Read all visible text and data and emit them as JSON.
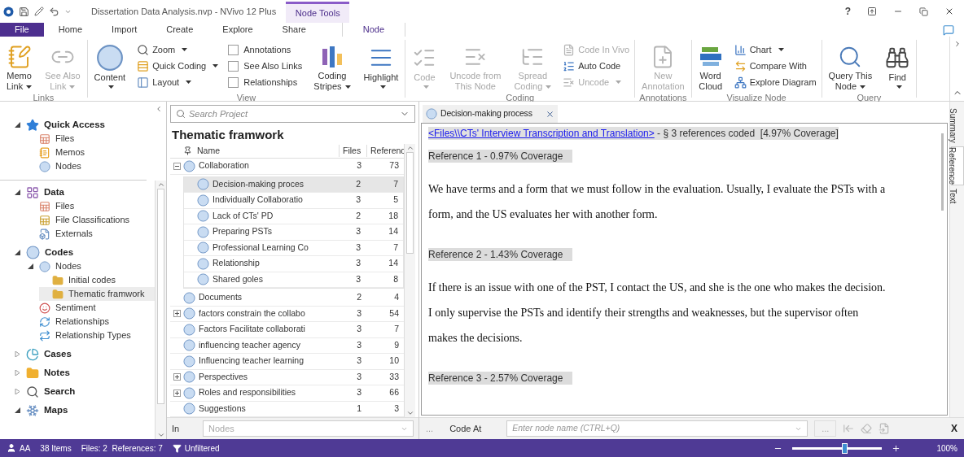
{
  "title_bar": {
    "title": "Dissertation Data Analysis.nvp - NVivo 12 Plus",
    "context_tab": "Node Tools",
    "help": "?"
  },
  "menu_tabs": [
    {
      "label": "File",
      "kind": "file",
      "selected": false
    },
    {
      "label": "Home",
      "kind": "tab",
      "selected": false
    },
    {
      "label": "Import",
      "kind": "tab",
      "selected": false
    },
    {
      "label": "Create",
      "kind": "tab",
      "selected": false
    },
    {
      "label": "Explore",
      "kind": "tab",
      "selected": false
    },
    {
      "label": "Share",
      "kind": "tab",
      "selected": false
    },
    {
      "label": "Node",
      "kind": "context",
      "selected": true
    }
  ],
  "ribbon": [
    {
      "label": "Links",
      "items": [
        {
          "kind": "large",
          "lines": [
            "Memo",
            "Link"
          ],
          "dropdown": true,
          "disabled": false
        },
        {
          "kind": "large",
          "lines": [
            "See Also",
            "Link"
          ],
          "dropdown": true,
          "disabled": true
        }
      ]
    },
    {
      "label": "View",
      "items": [
        {
          "kind": "large",
          "lines": [
            "Content"
          ],
          "dropdown": true,
          "disabled": false
        },
        {
          "kind": "stack",
          "items": [
            {
              "kind": "small",
              "label": "Zoom",
              "dropdown": true,
              "disabled": false
            },
            {
              "kind": "small",
              "label": "Quick Coding",
              "dropdown": true,
              "disabled": false
            },
            {
              "kind": "small",
              "label": "Layout",
              "dropdown": true,
              "disabled": false
            }
          ]
        },
        {
          "kind": "stack",
          "items": [
            {
              "kind": "check",
              "label": "Annotations",
              "checked": false
            },
            {
              "kind": "check",
              "label": "See Also Links",
              "checked": false
            },
            {
              "kind": "check",
              "label": "Relationships",
              "checked": false
            }
          ]
        },
        {
          "kind": "large",
          "lines": [
            "Coding",
            "Stripes"
          ],
          "dropdown": true,
          "disabled": false
        },
        {
          "kind": "large",
          "lines": [
            "Highlight"
          ],
          "dropdown": true,
          "disabled": false
        }
      ]
    },
    {
      "label": "Coding",
      "items": [
        {
          "kind": "large",
          "lines": [
            "Code"
          ],
          "dropdown": true,
          "disabled": true
        },
        {
          "kind": "large",
          "lines": [
            "Uncode from",
            "This Node"
          ],
          "dropdown": false,
          "disabled": true
        },
        {
          "kind": "large",
          "lines": [
            "Spread",
            "Coding"
          ],
          "dropdown": true,
          "disabled": true
        },
        {
          "kind": "stack",
          "items": [
            {
              "kind": "small",
              "label": "Code In Vivo",
              "dropdown": false,
              "disabled": true
            },
            {
              "kind": "small",
              "label": "Auto Code",
              "dropdown": false,
              "disabled": false
            },
            {
              "kind": "small",
              "label": "Uncode",
              "dropdown": true,
              "disabled": true
            }
          ]
        }
      ]
    },
    {
      "label": "Annotations",
      "items": [
        {
          "kind": "large",
          "lines": [
            "New",
            "Annotation"
          ],
          "dropdown": false,
          "disabled": true
        }
      ]
    },
    {
      "label": "Visualize Node",
      "items": [
        {
          "kind": "large",
          "lines": [
            "Word",
            "Cloud"
          ],
          "dropdown": false,
          "disabled": false
        },
        {
          "kind": "stack",
          "items": [
            {
              "kind": "small",
              "label": "Chart",
              "dropdown": true,
              "disabled": false
            },
            {
              "kind": "small",
              "label": "Compare With",
              "dropdown": false,
              "disabled": false
            },
            {
              "kind": "small",
              "label": "Explore Diagram",
              "dropdown": false,
              "disabled": false
            }
          ]
        }
      ]
    },
    {
      "label": "Query",
      "items": [
        {
          "kind": "large",
          "lines": [
            "Query This",
            "Node"
          ],
          "dropdown": true,
          "disabled": false
        },
        {
          "kind": "large",
          "lines": [
            "Find"
          ],
          "dropdown": true,
          "disabled": false
        }
      ]
    }
  ],
  "quick_access": {
    "label": "Quick Access",
    "kind": "star",
    "expanded": true,
    "selected": false,
    "children": [
      {
        "label": "Files",
        "kind": "files",
        "selected": false
      },
      {
        "label": "Memos",
        "kind": "memos",
        "selected": false
      },
      {
        "label": "Nodes",
        "kind": "nodes",
        "selected": false
      }
    ]
  },
  "navigation": [
    {
      "label": "Data",
      "kind": "data",
      "expanded": true,
      "selected": false,
      "children": [
        {
          "label": "Files",
          "kind": "files",
          "selected": false
        },
        {
          "label": "File Classifications",
          "kind": "classifications",
          "selected": false
        },
        {
          "label": "Externals",
          "kind": "externals",
          "selected": false
        }
      ]
    },
    {
      "label": "Codes",
      "kind": "codes",
      "expanded": true,
      "selected": false,
      "children": [
        {
          "label": "Nodes",
          "kind": "nodes",
          "expanded": true,
          "selected": false,
          "children": [
            {
              "label": "Initial codes",
              "kind": "folder",
              "selected": false
            },
            {
              "label": "Thematic framwork",
              "kind": "folder",
              "selected": true
            }
          ]
        },
        {
          "label": "Sentiment",
          "kind": "sentiment",
          "selected": false
        },
        {
          "label": "Relationships",
          "kind": "relationships",
          "selected": false
        },
        {
          "label": "Relationship Types",
          "kind": "relationship-types",
          "selected": false
        }
      ]
    },
    {
      "label": "Cases",
      "kind": "cases",
      "expanded": false,
      "selected": false
    },
    {
      "label": "Notes",
      "kind": "notes",
      "expanded": false,
      "selected": false
    },
    {
      "label": "Search",
      "kind": "search",
      "expanded": false,
      "selected": false
    },
    {
      "label": "Maps",
      "kind": "maps",
      "expanded": true,
      "selected": false
    }
  ],
  "node_list": {
    "search": {
      "placeholder": "Search Project"
    },
    "title": "Thematic framwork",
    "columns": [
      "Name",
      "Files",
      "Referenc"
    ],
    "rows": [
      {
        "name": "Collaboration",
        "files": "3",
        "references": "73",
        "kind": "group",
        "expanded": true,
        "selected": false,
        "children": [
          {
            "name": "Decision-making proces",
            "files": "2",
            "references": "7",
            "selected": true
          },
          {
            "name": "Individually Collaboratio",
            "files": "3",
            "references": "5",
            "selected": false
          },
          {
            "name": "Lack of CTs' PD",
            "files": "2",
            "references": "18",
            "selected": false
          },
          {
            "name": "Preparing PSTs",
            "files": "3",
            "references": "14",
            "selected": false
          },
          {
            "name": "Professional Learning Co",
            "files": "3",
            "references": "7",
            "selected": false
          },
          {
            "name": "Relationship",
            "files": "3",
            "references": "14",
            "selected": false
          },
          {
            "name": "Shared goles",
            "files": "3",
            "references": "8",
            "selected": false
          }
        ]
      },
      {
        "name": "Documents",
        "files": "2",
        "references": "4",
        "kind": "leaf",
        "selected": false
      },
      {
        "name": "factors constrain the collabo",
        "files": "3",
        "references": "54",
        "kind": "group",
        "expanded": false,
        "selected": false
      },
      {
        "name": "Factors Facilitate collaborati",
        "files": "3",
        "references": "7",
        "kind": "leaf",
        "selected": false
      },
      {
        "name": "influencing teacher agency",
        "files": "3",
        "references": "9",
        "kind": "leaf",
        "selected": false
      },
      {
        "name": "Influencing teacher learning",
        "files": "3",
        "references": "10",
        "kind": "leaf",
        "selected": false
      },
      {
        "name": "Perspectives",
        "files": "3",
        "references": "33",
        "kind": "group",
        "expanded": false,
        "selected": false
      },
      {
        "name": "Roles and responsibilities",
        "files": "3",
        "references": "66",
        "kind": "group",
        "expanded": false,
        "selected": false
      },
      {
        "name": "Suggestions",
        "files": "1",
        "references": "3",
        "kind": "leaf",
        "selected": false
      }
    ],
    "filter": {
      "label": "In",
      "placeholder": "Nodes"
    }
  },
  "document": {
    "tab": {
      "label": "Decision-making process",
      "selected": true
    },
    "source_link": "<Files\\\\CTs' Interview Transcription and Translation>",
    "summary": " - § 3 references coded  [4.97% Coverage]",
    "references": [
      {
        "heading": "Reference 1 - 0.97% Coverage",
        "text": "We have terms and a form that we must follow in the evaluation. Usually, I evaluate the PSTs with a form, and the US evaluates her with another form."
      },
      {
        "heading": "Reference 2 - 1.43% Coverage",
        "text": "If there is an issue with one of the PST, I contact the US, and she is the one who makes the decision. I only supervise the PSTs and identify their strengths and weaknesses, but the supervisor often makes the decisions."
      },
      {
        "heading": "Reference 3 - 2.57% Coverage"
      }
    ],
    "side_tabs": [
      {
        "label": "Summary",
        "selected": false
      },
      {
        "label": "Reference",
        "selected": true
      },
      {
        "label": "Text",
        "selected": false
      }
    ]
  },
  "code_at": {
    "leading_button": "...",
    "label": "Code At",
    "placeholder": "Enter node name (CTRL+Q)",
    "trailing_button": "...",
    "close": "X"
  },
  "status_bar": {
    "user": "AA",
    "items": "38 Items",
    "counts": "Files: 2  References: 7",
    "filter": "Unfiltered",
    "zoom": {
      "level": 0.58,
      "reading": "100%"
    }
  }
}
